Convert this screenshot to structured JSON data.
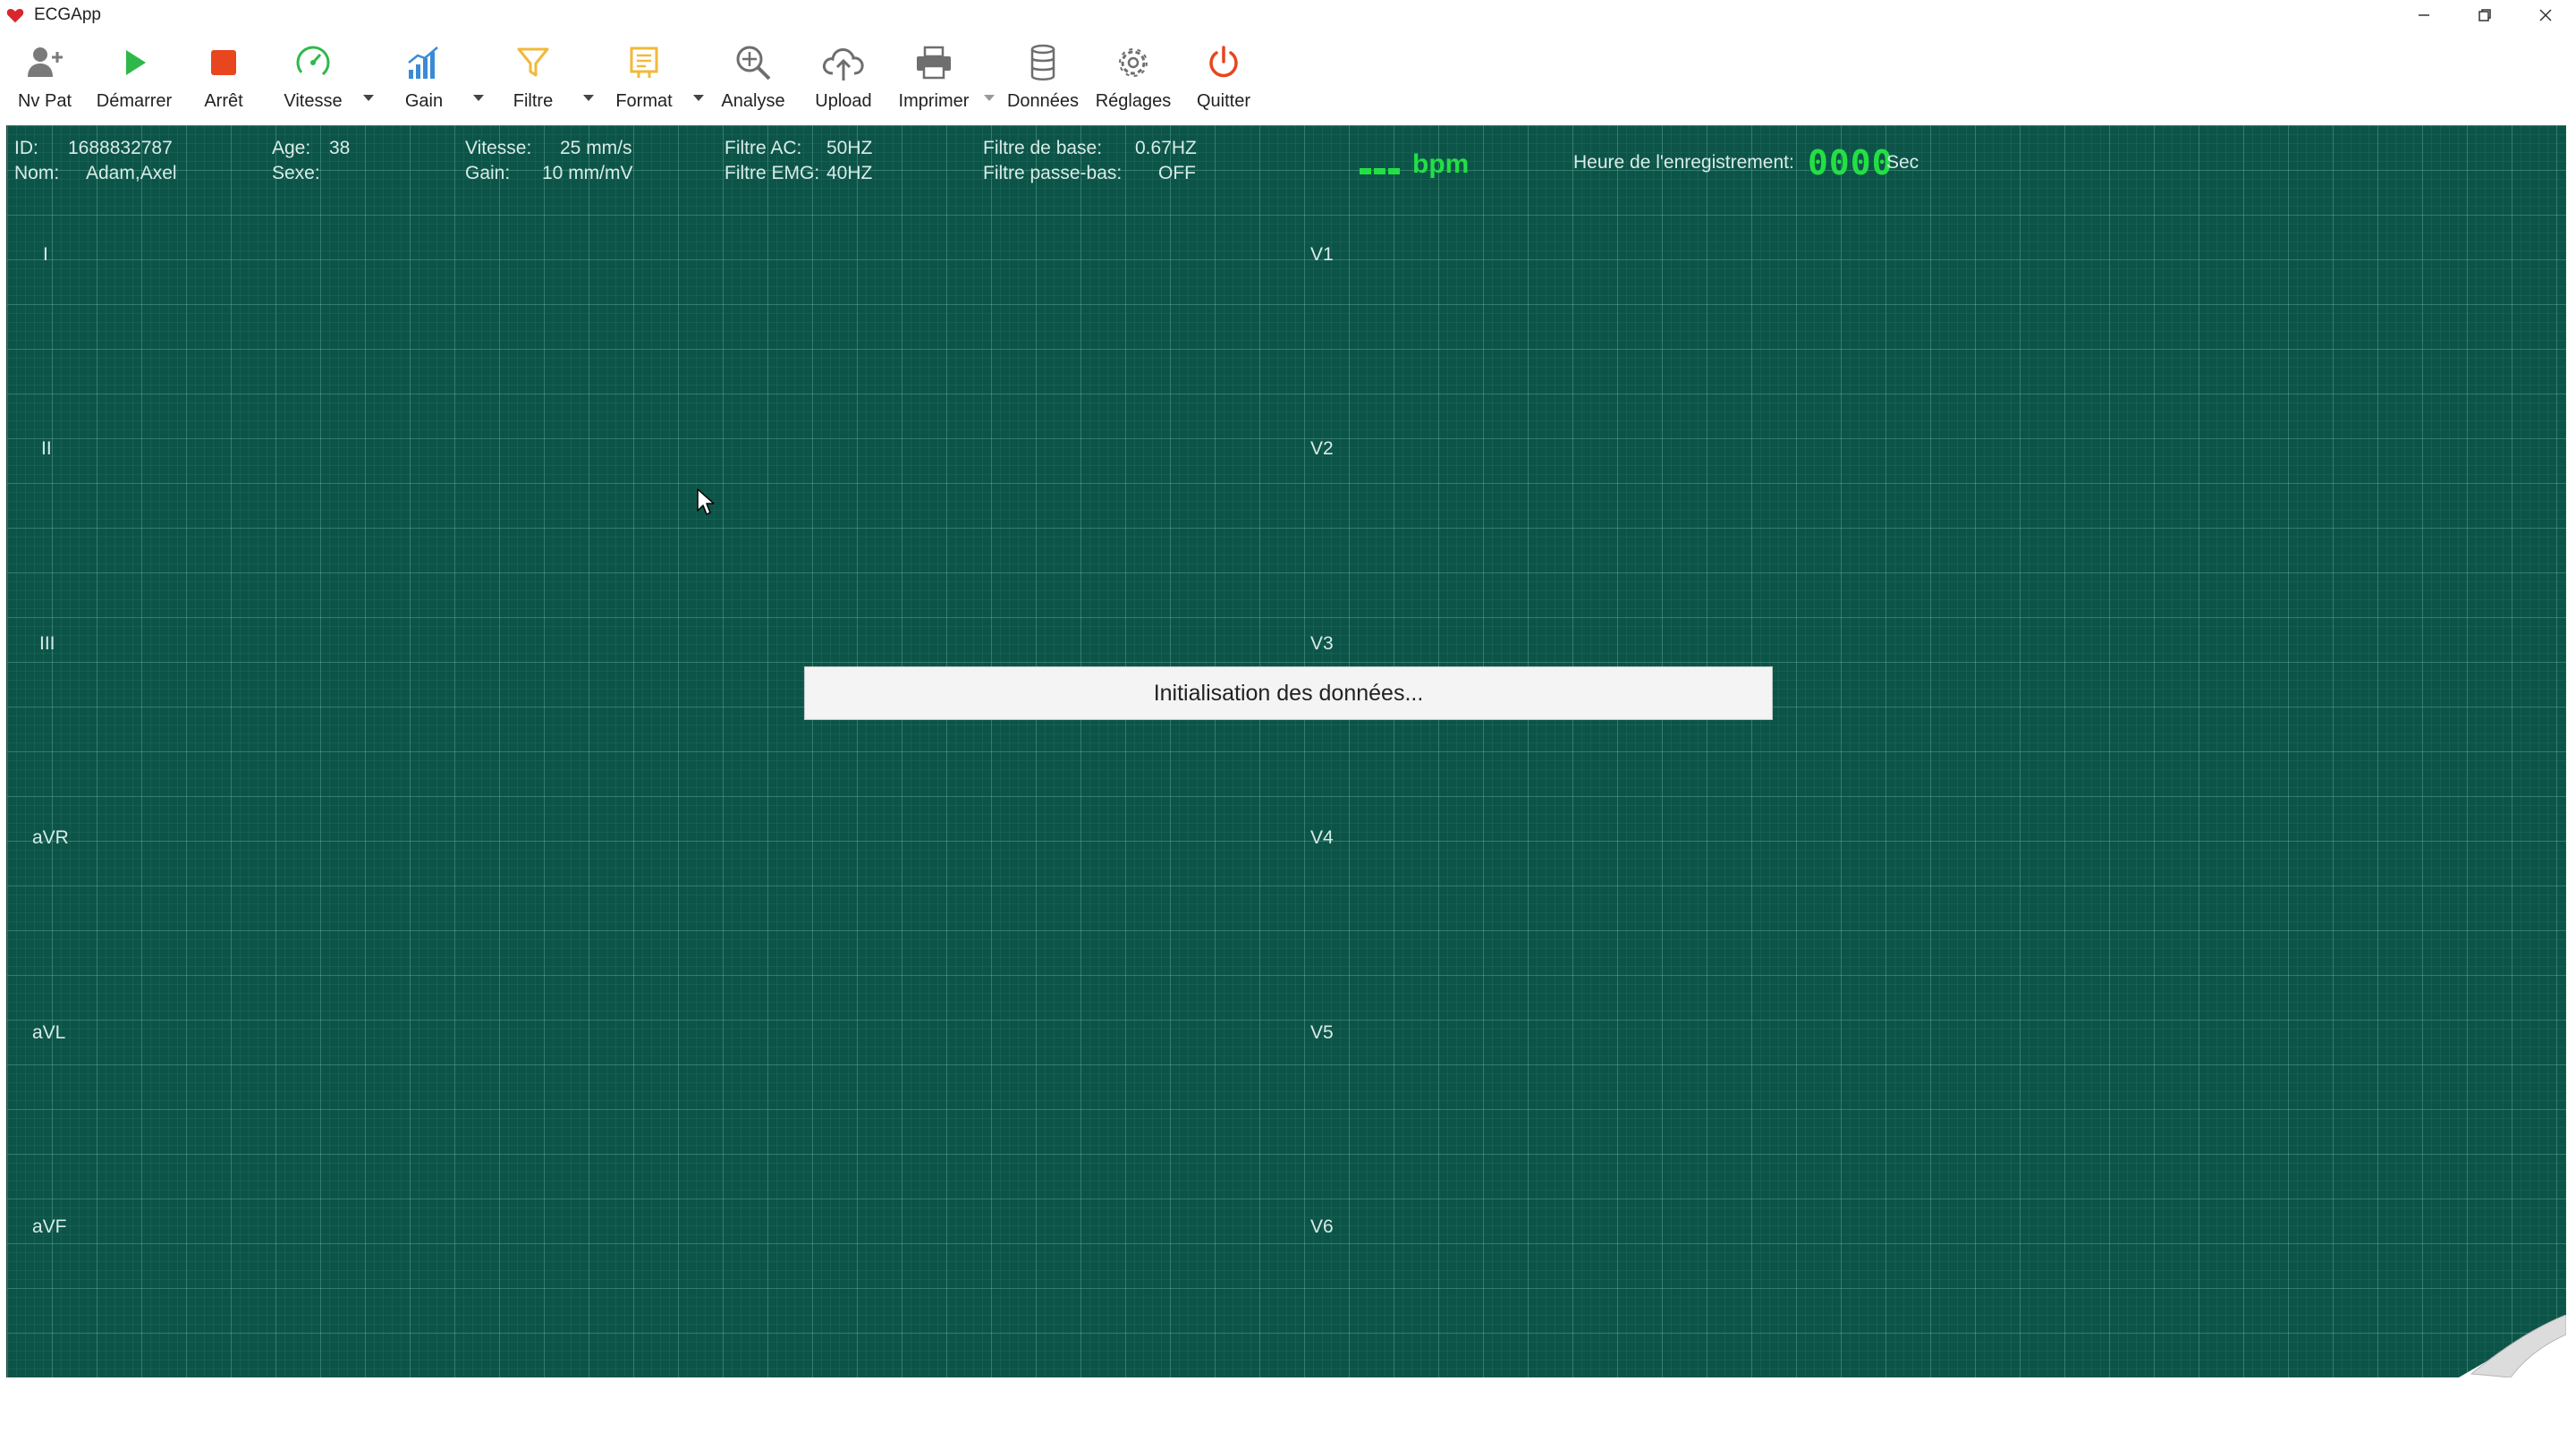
{
  "window": {
    "title": "ECGApp",
    "controls": [
      "minimize",
      "restore",
      "close"
    ]
  },
  "toolbar": {
    "items": [
      {
        "label": "Nv Pat",
        "icon": "add-user-icon"
      },
      {
        "label": "Démarrer",
        "icon": "play-icon",
        "color": "#2fb84a"
      },
      {
        "label": "Arrêt",
        "icon": "stop-icon",
        "color": "#e8461e"
      },
      {
        "label": "Vitesse",
        "icon": "speedometer-icon",
        "color": "#2fb84a"
      },
      {
        "label": "Gain",
        "icon": "signal-bars-icon",
        "color": "#3a8ad6"
      },
      {
        "label": "Filtre",
        "icon": "funnel-icon",
        "color": "#f1b93a"
      },
      {
        "label": "Format",
        "icon": "document-icon",
        "color": "#f1b93a"
      },
      {
        "label": "Analyse",
        "icon": "magnifier-icon"
      },
      {
        "label": "Upload",
        "icon": "cloud-upload-icon"
      },
      {
        "label": "Imprimer",
        "icon": "printer-icon"
      },
      {
        "label": "Données",
        "icon": "database-icon"
      },
      {
        "label": "Réglages",
        "icon": "gear-icon"
      },
      {
        "label": "Quitter",
        "icon": "power-icon",
        "color": "#e8461e"
      }
    ]
  },
  "patient": {
    "id_label": "ID:",
    "id_value": "1688832787",
    "name_label": "Nom:",
    "name_value": "Adam,Axel",
    "age_label": "Age:",
    "age_value": "38",
    "sex_label": "Sexe:",
    "sex_value": ""
  },
  "settings": {
    "speed_label": "Vitesse:",
    "speed_value": "25 mm/s",
    "gain_label": "Gain:",
    "gain_value": "10 mm/mV",
    "ac_label": "Filtre AC:",
    "ac_value": "50HZ",
    "emg_label": "Filtre EMG:",
    "emg_value": "40HZ",
    "base_label": "Filtre de base:",
    "base_value": "0.67HZ",
    "lowpass_label": "Filtre passe-bas:",
    "lowpass_value": "OFF"
  },
  "heart_rate": {
    "unit": "bpm",
    "color": "#22e044"
  },
  "recording": {
    "label": "Heure de l'enregistrement:",
    "value": "0000",
    "unit": "Sec"
  },
  "leads": {
    "left": [
      "I",
      "II",
      "III",
      "aVR",
      "aVL",
      "aVF"
    ],
    "right": [
      "V1",
      "V2",
      "V3",
      "V4",
      "V5",
      "V6"
    ]
  },
  "status": {
    "message": "Initialisation des données..."
  },
  "colors": {
    "grid_background": "#0d5448",
    "accent_green": "#22e044"
  }
}
